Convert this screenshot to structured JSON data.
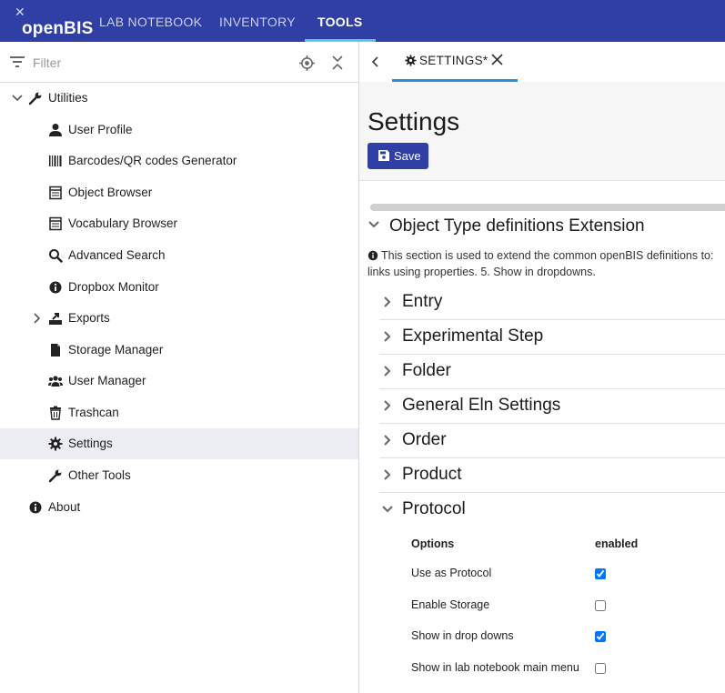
{
  "header": {
    "logo_text": "openBIS",
    "nav": [
      "LAB NOTEBOOK",
      "INVENTORY",
      "TOOLS"
    ],
    "active_nav": "TOOLS",
    "accent_color": "#2f3fa6",
    "underline_color": "#5ec8f2"
  },
  "sidebar": {
    "filter_placeholder": "Filter",
    "root_label": "Utilities",
    "items": [
      {
        "label": "User Profile",
        "icon": "user-icon"
      },
      {
        "label": "Barcodes/QR codes Generator",
        "icon": "barcode-icon"
      },
      {
        "label": "Object Browser",
        "icon": "table-icon"
      },
      {
        "label": "Vocabulary Browser",
        "icon": "table-icon"
      },
      {
        "label": "Advanced Search",
        "icon": "search-icon"
      },
      {
        "label": "Dropbox Monitor",
        "icon": "info-icon"
      },
      {
        "label": "Exports",
        "icon": "export-icon"
      },
      {
        "label": "Storage Manager",
        "icon": "file-icon"
      },
      {
        "label": "User Manager",
        "icon": "users-icon"
      },
      {
        "label": "Trashcan",
        "icon": "trash-icon"
      },
      {
        "label": "Settings",
        "icon": "gear-icon"
      },
      {
        "label": "Other Tools",
        "icon": "wrench-icon"
      }
    ],
    "selected_item": "Settings",
    "about_label": "About"
  },
  "tab": {
    "label": "SETTINGS*"
  },
  "page": {
    "title": "Settings",
    "save_label": "Save",
    "section_title": "Object Type definitions Extension",
    "description_line1": "This section is used to extend the common openBIS definitions to:",
    "description_line2": "links using properties. 5. Show in dropdowns.",
    "types": [
      "Entry",
      "Experimental Step",
      "Folder",
      "General Eln Settings",
      "Order",
      "Product",
      "Protocol"
    ],
    "expanded_type": "Protocol",
    "options_header": "Options",
    "enabled_header": "enabled",
    "options": [
      {
        "label": "Use as Protocol",
        "enabled": true
      },
      {
        "label": "Enable Storage",
        "enabled": false
      },
      {
        "label": "Show in drop downs",
        "enabled": true
      },
      {
        "label": "Show in lab notebook main menu",
        "enabled": false
      }
    ]
  }
}
